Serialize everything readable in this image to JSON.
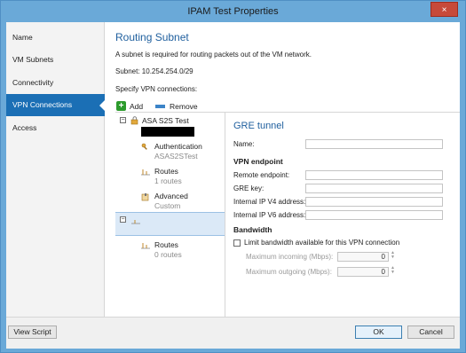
{
  "window": {
    "title": "IPAM Test Properties",
    "close_glyph": "×"
  },
  "nav": {
    "items": [
      {
        "label": "Name",
        "selected": false
      },
      {
        "label": "VM Subnets",
        "selected": false
      },
      {
        "label": "Connectivity",
        "selected": false
      },
      {
        "label": "VPN Connections",
        "selected": true
      },
      {
        "label": "Access",
        "selected": false
      }
    ]
  },
  "main": {
    "heading": "Routing Subnet",
    "description": "A subnet is required for routing packets out of the VM network.",
    "subnet": "Subnet: 10.254.254.0/29",
    "specify": "Specify VPN connections:"
  },
  "toolbar": {
    "add_label": "Add",
    "remove_label": "Remove"
  },
  "tree": {
    "connection_name": "ASA S2S Test",
    "authentication": {
      "label": "Authentication",
      "value": "ASAS2STest"
    },
    "routes": {
      "label": "Routes",
      "value": "1 routes"
    },
    "advanced": {
      "label": "Advanced",
      "value": "Custom"
    },
    "routes2": {
      "label": "Routes",
      "value": "0 routes"
    }
  },
  "details": {
    "title": "GRE tunnel",
    "name_label": "Name:",
    "vpn_endpoint_header": "VPN endpoint",
    "remote_endpoint_label": "Remote endpoint:",
    "gre_key_label": "GRE key:",
    "ipv4_label": "Internal IP V4 address:",
    "ipv6_label": "Internal IP V6 address:",
    "bandwidth_header": "Bandwidth",
    "limit_label": "Limit bandwidth available for this VPN connection",
    "incoming_label": "Maximum incoming (Mbps):",
    "incoming_value": "0",
    "outgoing_label": "Maximum outgoing (Mbps):",
    "outgoing_value": "0"
  },
  "footer": {
    "view_script": "View Script",
    "ok": "OK",
    "cancel": "Cancel"
  },
  "colors": {
    "accent": "#1b6fb5",
    "title_bar": "#6aa9d8",
    "heading": "#1f5f9e"
  }
}
